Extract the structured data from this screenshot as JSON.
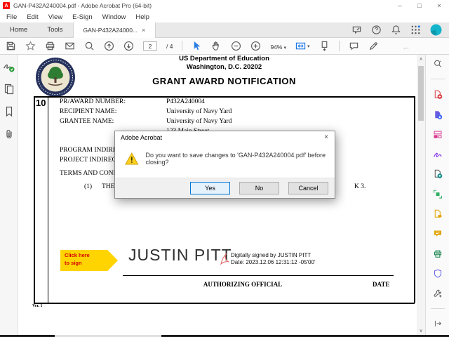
{
  "window": {
    "title": "GAN-P432A240004.pdf - Adobe Acrobat Pro (64-bit)",
    "logo_letter": "A"
  },
  "icons": {
    "minimize": "–",
    "maximize": "□",
    "close": "×",
    "tab_close": "×",
    "dropdown": "▾",
    "ellipsis": "…",
    "scroll_up": "∧",
    "scroll_down": "∨",
    "help": "?"
  },
  "menu": {
    "items": [
      "File",
      "Edit",
      "View",
      "E-Sign",
      "Window",
      "Help"
    ]
  },
  "tabs": {
    "home": "Home",
    "tools": "Tools",
    "document": "GAN-P432A24000..."
  },
  "toolbar": {
    "page_current": "2",
    "page_separator": "/ 4",
    "zoom_level": "94%"
  },
  "dialog": {
    "title": "Adobe Acrobat",
    "message": "Do you want to save changes to 'GAN-P432A240004.pdf' before closing?",
    "buttons": {
      "yes": "Yes",
      "no": "No",
      "cancel": "Cancel"
    }
  },
  "document": {
    "page_number": "10",
    "header_line1": "US Department of Education",
    "header_line2": "Washington, D.C. 20202",
    "header_line3": "GRANT AWARD NOTIFICATION",
    "fields": [
      {
        "label": "PR/AWARD NUMBER:",
        "value": "P432A240004"
      },
      {
        "label": "RECIPIENT NAME:",
        "value": "University of Navy Yard"
      },
      {
        "label": "GRANTEE NAME:",
        "value": "University of Navy Yard"
      },
      {
        "label": "",
        "value": "123 Main Street"
      }
    ],
    "fragments": {
      "program_line": "PROGRAM INDIRE",
      "project_line": "PROJECT INDIREC",
      "terms_line": "TERMS AND COND",
      "item_number": "(1)",
      "item_text": "THE REC",
      "right_fragment": "K 3."
    },
    "signature": {
      "tag_line1": "Click here",
      "tag_line2": "to sign",
      "name": "JUSTIN PITT",
      "digital_line1": "Digitally signed by JUSTIN PITT",
      "digital_line2": "Date: 2023.12.06 12:31:12 -05'00'"
    },
    "footer": {
      "authorizing": "AUTHORIZING OFFICIAL",
      "date": "DATE",
      "version": "Ver. 1"
    }
  },
  "colors": {
    "accent_blue": "#1473e6",
    "adobe_red": "#fa0f00",
    "warning_yellow": "#ffd021",
    "sign_tag_yellow": "#ffd400",
    "sign_tag_text": "#d60000",
    "avatar_teal": "#12b5cb",
    "default_button_border": "#0078d7"
  }
}
